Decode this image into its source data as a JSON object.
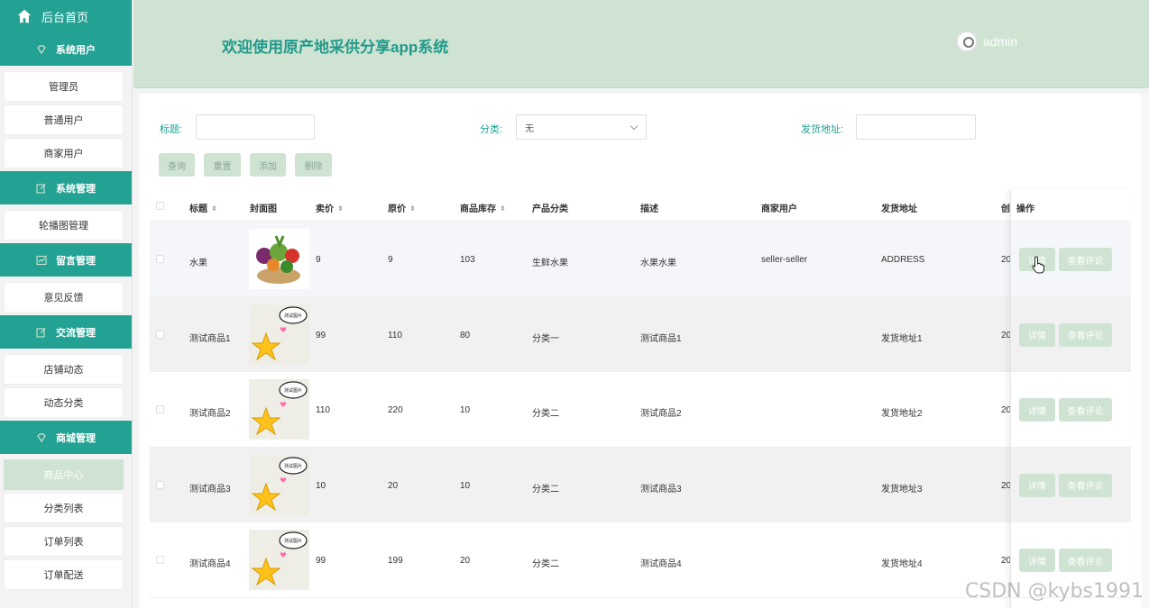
{
  "sidebar": {
    "home": "后台首页",
    "groups": [
      {
        "label": "系统用户",
        "items": [
          "管理员",
          "普通用户",
          "商家用户"
        ]
      },
      {
        "label": "系统管理",
        "items": [
          "轮播图管理"
        ]
      },
      {
        "label": "留言管理",
        "items": [
          "意见反馈"
        ]
      },
      {
        "label": "交流管理",
        "items": [
          "店铺动态",
          "动态分类"
        ]
      },
      {
        "label": "商城管理",
        "items": [
          "商品中心",
          "分类列表",
          "订单列表",
          "订单配送"
        ]
      }
    ]
  },
  "header": {
    "title": "欢迎使用原产地采供分享app系统",
    "user": "admin"
  },
  "filters": {
    "title_label": "标题:",
    "title_value": "",
    "category_label": "分类:",
    "category_value": "无",
    "address_label": "发货地址:",
    "address_value": ""
  },
  "buttons": {
    "query": "查询",
    "reset": "重置",
    "add": "添加",
    "delete": "删除"
  },
  "table": {
    "headers": {
      "title": "标题",
      "cover": "封面图",
      "price": "卖价",
      "original": "原价",
      "stock": "商品库存",
      "category": "产品分类",
      "desc": "描述",
      "merchant": "商家用户",
      "address": "发货地址",
      "created": "创",
      "ops": "操作"
    },
    "rows": [
      {
        "title": "水果",
        "price": "9",
        "original": "9",
        "stock": "103",
        "category": "生鲜水果",
        "desc": "水果水果",
        "merchant": "seller-seller",
        "address": "ADDRESS",
        "created": "20",
        "detail": "详情",
        "comments": "查看评论"
      },
      {
        "title": "测试商品1",
        "price": "99",
        "original": "110",
        "stock": "80",
        "category": "分类一",
        "desc": "测试商品1",
        "merchant": "",
        "address": "发货地址1",
        "created": "20",
        "detail": "详情",
        "comments": "查看评论"
      },
      {
        "title": "测试商品2",
        "price": "110",
        "original": "220",
        "stock": "10",
        "category": "分类二",
        "desc": "测试商品2",
        "merchant": "",
        "address": "发货地址2",
        "created": "20",
        "detail": "详情",
        "comments": "查看评论"
      },
      {
        "title": "测试商品3",
        "price": "10",
        "original": "20",
        "stock": "10",
        "category": "分类二",
        "desc": "测试商品3",
        "merchant": "",
        "address": "发货地址3",
        "created": "20",
        "detail": "详情",
        "comments": "查看评论"
      },
      {
        "title": "测试商品4",
        "price": "99",
        "original": "199",
        "stock": "20",
        "category": "分类二",
        "desc": "测试商品4",
        "merchant": "",
        "address": "发货地址4",
        "created": "20",
        "detail": "详情",
        "comments": "查看评论"
      }
    ],
    "thumb_caption": "测试图片"
  },
  "watermark": "CSDN @kybs1991",
  "colors": {
    "primary": "#23a293",
    "light": "#cfe3d2",
    "header_bg": "#cfe3d2"
  }
}
